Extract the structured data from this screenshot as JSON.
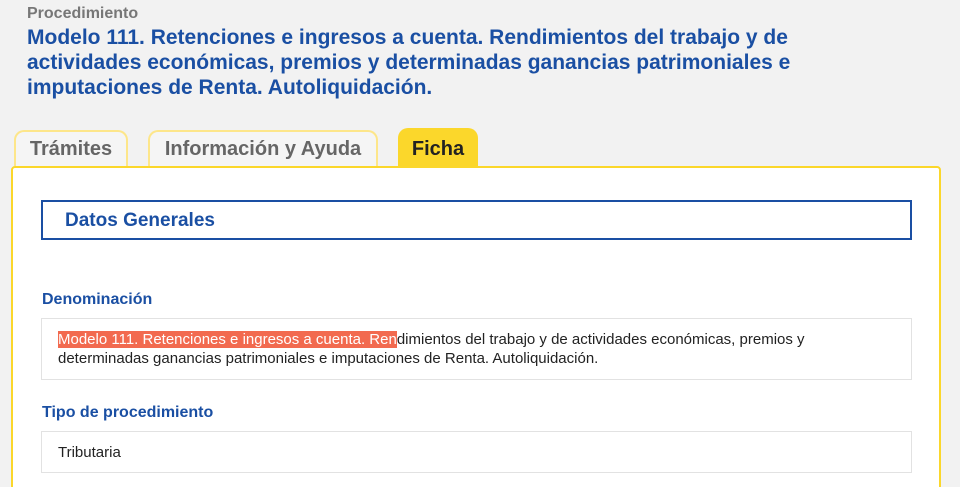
{
  "header": {
    "label": "Procedimiento",
    "title": "Modelo 111. Retenciones e ingresos a cuenta. Rendimientos del trabajo y de actividades económicas, premios y determinadas ganancias patrimoniales e imputaciones de Renta. Autoliquidación."
  },
  "tabs": [
    {
      "label": "Trámites"
    },
    {
      "label": "Información y Ayuda"
    },
    {
      "label": "Ficha",
      "active": true
    }
  ],
  "panel": {
    "section_title": "Datos Generales",
    "fields": {
      "denominacion": {
        "label": "Denominación",
        "value_highlighted": "Modelo 111. Retenciones e ingresos a cuenta. Ren",
        "value_rest": "dimientos del trabajo y de actividades económicas, premios y determinadas ganancias patrimoniales e imputaciones de Renta. Autoliquidación."
      },
      "tipo": {
        "label": "Tipo de procedimiento",
        "value": "Tributaria"
      }
    }
  },
  "colors": {
    "accent_blue": "#1a4fa3",
    "tab_active_yellow": "#fbd72b",
    "selection_highlight": "#f26a4f"
  }
}
